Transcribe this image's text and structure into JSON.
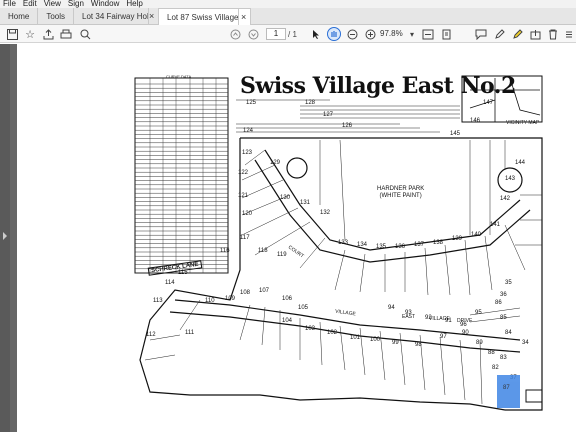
{
  "menu": [
    "File",
    "Edit",
    "View",
    "Sign",
    "Window",
    "Help"
  ],
  "tabs": [
    {
      "label": "Home",
      "active": false
    },
    {
      "label": "Tools",
      "active": false
    },
    {
      "label": "Lot 34 Fairway Holt...",
      "active": false,
      "close": "×"
    },
    {
      "label": "Lot 87 Swiss Village...",
      "active": true,
      "close": "×"
    }
  ],
  "toolbar": {
    "icons": [
      "save-icon",
      "bookmark-star-icon",
      "upload-icon",
      "print-icon",
      "zoom-search-icon",
      "prev-page-icon",
      "next-page-icon",
      "cursor-icon",
      "hand-icon",
      "zoom-out-icon",
      "zoom-in-icon",
      "zoom-dropdown-icon",
      "fit-page-icon",
      "scroll-mode-icon",
      "comment-icon",
      "pen-icon",
      "highlight-icon",
      "share-icon",
      "delete-icon",
      "more-icon"
    ],
    "page_current": "1",
    "page_total": "/ 1",
    "zoom": "97.8%"
  },
  "document": {
    "title": "Swiss Village East No.2",
    "curve_table_title": "CURVE DATA",
    "park_label": [
      "HARDNER PARK",
      "(WHITE PAINT)"
    ],
    "road_labels": [
      "SCHRECK LANE",
      "VILLAGE",
      "EAST",
      "VILLAGE",
      "DRIVE",
      "COURT"
    ],
    "vicinity": "VICINITY MAP",
    "highlighted_lot": "87",
    "lots": [
      "125",
      "128",
      "127",
      "126",
      "124",
      "123",
      "122",
      "121",
      "120",
      "129",
      "130",
      "131",
      "132",
      "133",
      "134",
      "135",
      "136",
      "137",
      "138",
      "139",
      "140",
      "141",
      "142",
      "143",
      "144",
      "145",
      "146",
      "147",
      "117",
      "118",
      "119",
      "116",
      "115",
      "114",
      "113",
      "112",
      "111",
      "110",
      "109",
      "108",
      "107",
      "106",
      "105",
      "104",
      "103",
      "102",
      "101",
      "100",
      "99",
      "98",
      "97",
      "96",
      "95",
      "94",
      "93",
      "92",
      "91",
      "90",
      "89",
      "88",
      "86",
      "85",
      "84",
      "83",
      "82",
      "37",
      "36",
      "35",
      "34"
    ]
  },
  "colors": {
    "highlight": "#3f86e5",
    "toolbar_bg": "#f7f7f7",
    "doc_bg": "#666666"
  }
}
